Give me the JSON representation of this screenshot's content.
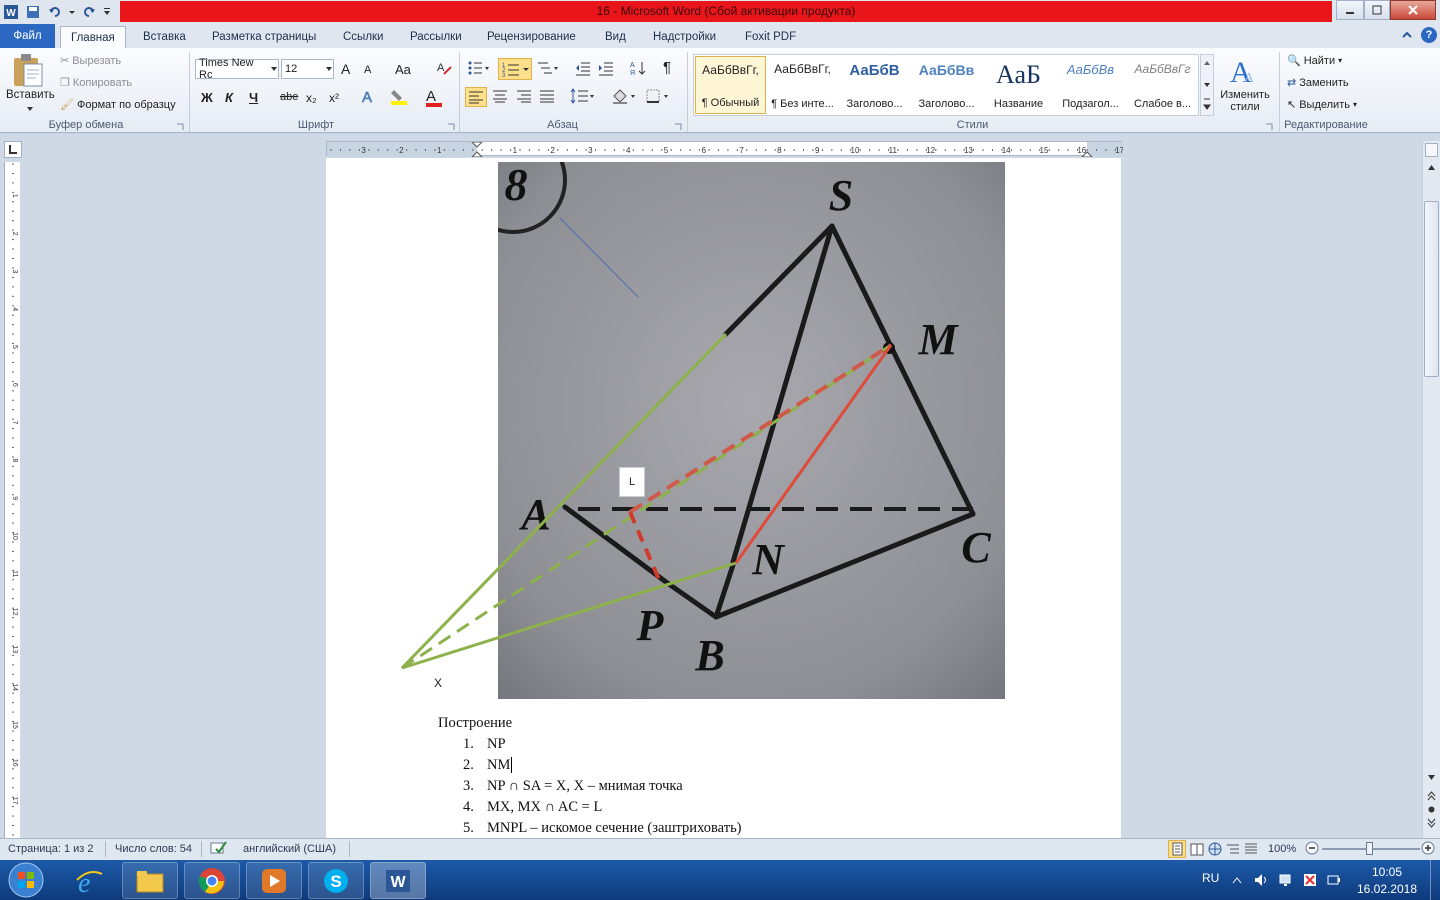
{
  "window": {
    "title": "16  -  Microsoft Word (Сбой активации продукта)",
    "help_label": "?"
  },
  "tabs": [
    {
      "label": "Файл"
    },
    {
      "label": "Главная"
    },
    {
      "label": "Вставка"
    },
    {
      "label": "Разметка страницы"
    },
    {
      "label": "Ссылки"
    },
    {
      "label": "Рассылки"
    },
    {
      "label": "Рецензирование"
    },
    {
      "label": "Вид"
    },
    {
      "label": "Надстройки"
    },
    {
      "label": "Foxit PDF"
    }
  ],
  "clipboard": {
    "paste": "Вставить",
    "cut": "Вырезать",
    "copy": "Копировать",
    "format_painter": "Формат по образцу",
    "group": "Буфер обмена"
  },
  "font": {
    "name": "Times New Rc",
    "size": "12",
    "group": "Шрифт",
    "bold": "Ж",
    "italic": "К",
    "underline": "Ч",
    "strike": "abe",
    "sub": "x₂",
    "sup": "x²",
    "grow": "A",
    "shrink": "A",
    "case": "Aa",
    "color_a": "A"
  },
  "paragraph": {
    "group": "Абзац",
    "pilcrow": "¶"
  },
  "styles": {
    "group": "Стили",
    "items": [
      {
        "preview": "АаБбВвГг,",
        "name": "¶ Обычный"
      },
      {
        "preview": "АаБбВвГг,",
        "name": "¶ Без инте..."
      },
      {
        "preview": "АаБбВ",
        "name": "Заголово..."
      },
      {
        "preview": "АаБбВв",
        "name": "Заголово..."
      },
      {
        "preview": "АаБ",
        "name": "Название"
      },
      {
        "preview": "АаБбВв",
        "name": "Подзагол..."
      },
      {
        "preview": "АаБбВвГг",
        "name": "Слабое в..."
      }
    ],
    "change_styles_1": "Изменить",
    "change_styles_2": "стили"
  },
  "editing": {
    "group": "Редактирование",
    "find": "Найти",
    "replace": "Заменить",
    "select": "Выделить"
  },
  "ruler": {
    "marks": [
      "3",
      "2",
      "1",
      "1",
      "2",
      "3",
      "4",
      "5",
      "6",
      "7",
      "8",
      "9",
      "10",
      "11",
      "12",
      "13",
      "14",
      "15",
      "16",
      "17"
    ]
  },
  "document": {
    "photo_labels": {
      "S": "S",
      "M": "M",
      "A": "A",
      "N": "N",
      "C": "C",
      "P": "P",
      "B": "B",
      "eight": "8"
    },
    "label_L": "L",
    "label_X": "X",
    "heading": "Построение",
    "steps": [
      {
        "num": "1.",
        "text": "NP"
      },
      {
        "num": "2.",
        "text": "NM"
      },
      {
        "num": "3.",
        "text": "NP ∩ SA = X, X – мнимая точка"
      },
      {
        "num": "4.",
        "text": "MX, MX ∩ AC = L"
      },
      {
        "num": "5.",
        "text": "MNPL – искомое сечение (заштриховать)"
      }
    ]
  },
  "status": {
    "page": "Страница: 1 из 2",
    "words": "Число слов: 54",
    "language": "английский (США)",
    "zoom": "100%"
  },
  "taskbar": {
    "lang": "RU",
    "time": "10:05",
    "date": "16.02.2018"
  }
}
